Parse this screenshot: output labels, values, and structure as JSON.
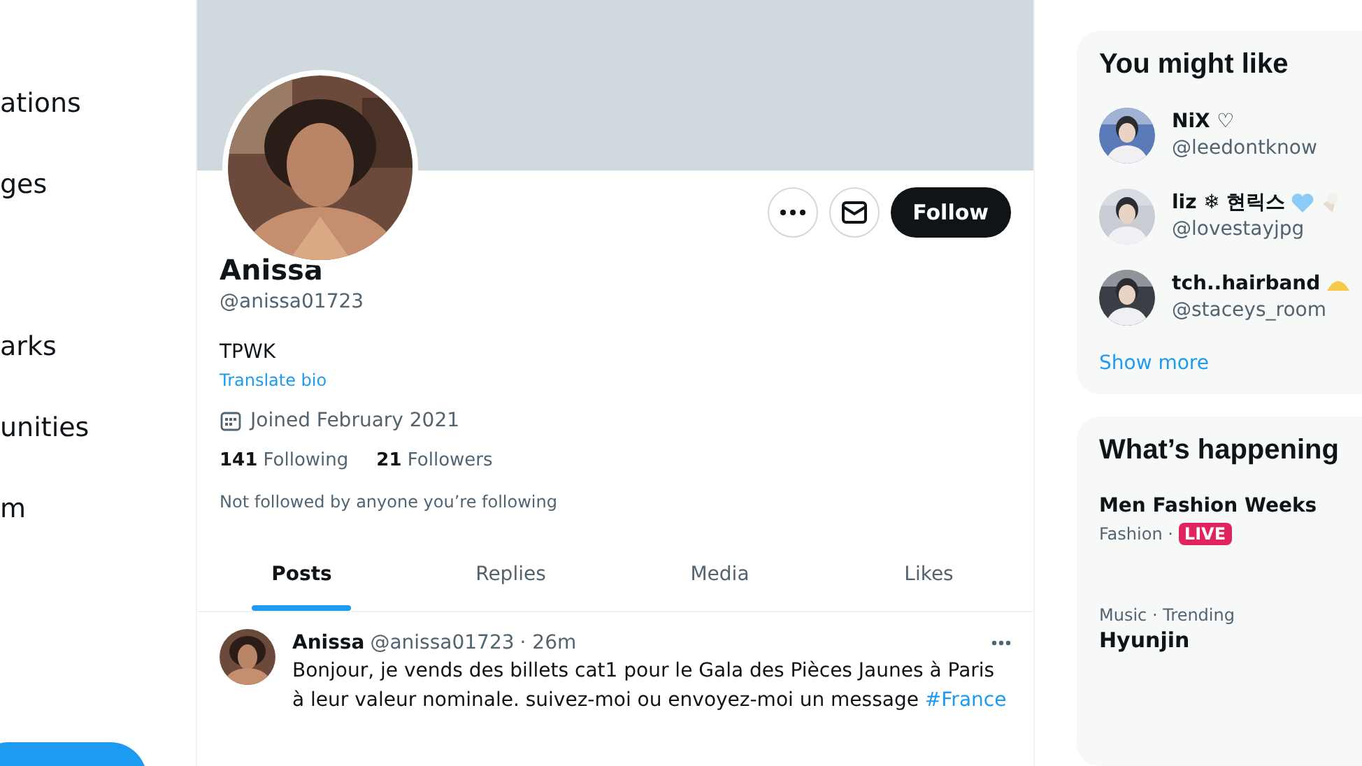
{
  "nav": {
    "items": [
      {
        "label": "ations"
      },
      {
        "label": "ges"
      },
      {
        "label": "arks"
      },
      {
        "label": "unities"
      },
      {
        "label": "m"
      }
    ]
  },
  "profile": {
    "name": "Anissa",
    "handle": "@anissa01723",
    "bio": "TPWK",
    "translate": "Translate bio",
    "joined": "Joined February 2021",
    "following_count": "141",
    "following_label": "Following",
    "followers_count": "21",
    "followers_label": "Followers",
    "note": "Not followed by anyone you’re following",
    "follow_button": "Follow"
  },
  "tabs": [
    {
      "label": "Posts",
      "selected": true
    },
    {
      "label": "Replies",
      "selected": false
    },
    {
      "label": "Media",
      "selected": false
    },
    {
      "label": "Likes",
      "selected": false
    }
  ],
  "post": {
    "name": "Anissa",
    "handle": "@anissa01723",
    "time": "· 26m",
    "text": "Bonjour, je vends des billets cat1 pour le Gala des Pièces Jaunes à Paris à leur valeur nominale. suivez-moi ou envoyez-moi un message",
    "hashtag": "#France"
  },
  "you_might_like": {
    "title": "You might like",
    "users": [
      {
        "name": "NiX ♡",
        "handle": "@leedontknow"
      },
      {
        "name": "liz ❄ 현릭스",
        "handle": "@lovestayjpg"
      },
      {
        "name": "tch..hairband",
        "handle": "@staceys_room"
      }
    ],
    "show_more": "Show more"
  },
  "happening": {
    "title": "What’s happening",
    "trends": [
      {
        "kind": "live",
        "title": "Men Fashion Weeks",
        "context": "Fashion ·",
        "badge": "LIVE"
      },
      {
        "kind": "trend",
        "context": "Music · Trending",
        "title": "Hyunjin"
      }
    ]
  }
}
